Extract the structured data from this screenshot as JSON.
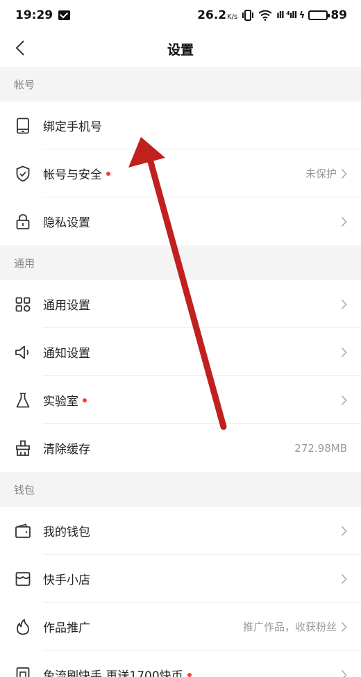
{
  "status_bar": {
    "time": "19:29",
    "speed": "26.2",
    "speed_unit": "K/s",
    "signal": "ıll ⁴ıll ϟ",
    "battery": "89",
    "battery_fraction": 0.89,
    "battery_color": "#2bb24c"
  },
  "nav": {
    "title": "设置"
  },
  "sections": [
    {
      "header": "帐号"
    },
    {
      "header": "通用"
    },
    {
      "header": "钱包"
    }
  ],
  "rows": {
    "bind_phone": {
      "label": "绑定手机号"
    },
    "account_security": {
      "label": "帐号与安全",
      "value": "未保护"
    },
    "privacy": {
      "label": "隐私设置"
    },
    "general_settings": {
      "label": "通用设置"
    },
    "notification": {
      "label": "通知设置"
    },
    "lab": {
      "label": "实验室"
    },
    "clear_cache": {
      "label": "清除缓存",
      "value": "272.98MB"
    },
    "wallet": {
      "label": "我的钱包"
    },
    "shop": {
      "label": "快手小店"
    },
    "promotion": {
      "label": "作品推广",
      "value": "推广作品，收获粉丝"
    },
    "free_traffic": {
      "label": "免流刷快手 再送1700快币"
    }
  },
  "colors": {
    "accent_dot": "#ff3b30",
    "arrow": "#c0201e"
  }
}
